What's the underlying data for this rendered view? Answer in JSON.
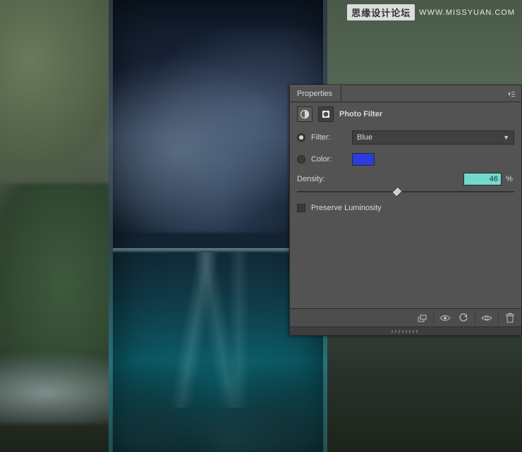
{
  "watermark": {
    "main": "思缘设计论坛",
    "url": "WWW.MISSYUAN.COM"
  },
  "panel": {
    "title": "Properties",
    "subtitle": "Photo Filter",
    "filter_label": "Filter:",
    "filter_value": "Blue",
    "color_label": "Color:",
    "color_hex": "#2b3bdc",
    "density_label": "Density:",
    "density_value": "46",
    "density_unit": "%",
    "preserve_label": "Preserve Luminosity",
    "selected_option": "filter",
    "preserve_checked": false
  },
  "icons": {
    "adjustment": "adjustment-icon",
    "mask": "mask-icon",
    "clip": "clip-to-layer-icon",
    "prev": "view-previous-state-icon",
    "reset": "reset-icon",
    "visibility": "visibility-icon",
    "trash": "trash-icon"
  }
}
